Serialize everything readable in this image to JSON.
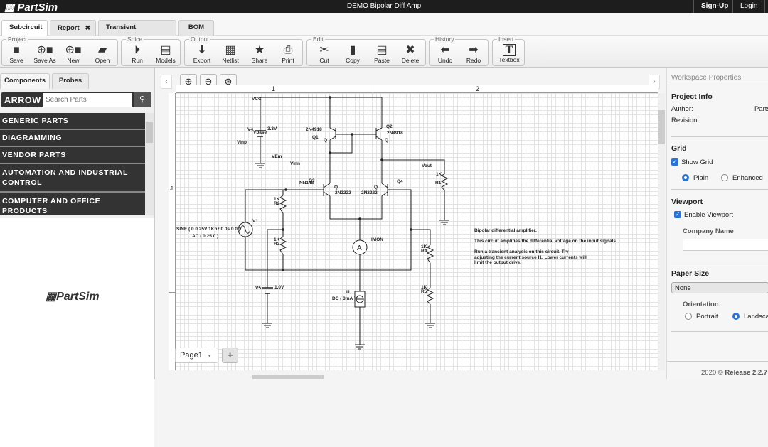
{
  "app": {
    "logo": "PartSim",
    "title": "DEMO Bipolar Diff Amp",
    "signup": "Sign-Up",
    "login": "Login"
  },
  "tabs": [
    {
      "label": "Subcircuit",
      "active": true
    },
    {
      "label": "Report",
      "closable": true
    },
    {
      "label": "Transient Analysis",
      "closable": true
    },
    {
      "label": "BOM"
    }
  ],
  "toolbar": {
    "groups": [
      {
        "label": "Project",
        "tools": [
          "Save",
          "Save As",
          "New",
          "Open"
        ]
      },
      {
        "label": "Spice",
        "tools": [
          "Run",
          "Models"
        ]
      },
      {
        "label": "Output",
        "tools": [
          "Export",
          "Netlist",
          "Share",
          "Print"
        ]
      },
      {
        "label": "Edit",
        "tools": [
          "Cut",
          "Copy",
          "Paste",
          "Delete"
        ]
      },
      {
        "label": "History",
        "tools": [
          "Undo",
          "Redo"
        ]
      },
      {
        "label": "Insert",
        "tools": [
          "Textbox"
        ]
      }
    ]
  },
  "left": {
    "tabs": [
      "Components",
      "Probes"
    ],
    "brand": "ARROW",
    "search_placeholder": "Search Parts",
    "categories": [
      "GENERIC PARTS",
      "DIAGRAMMING",
      "VENDOR PARTS",
      "AUTOMATION AND INDUSTRIAL CONTROL",
      "COMPUTER AND OFFICE PRODUCTS"
    ],
    "preview_logo": "PartSim"
  },
  "canvas": {
    "ruler_cols": [
      "1",
      "2"
    ],
    "ruler_rows": [
      "J"
    ],
    "page_tab": "Page1",
    "add_page": "+",
    "schematic": {
      "vcc": "VCC",
      "v4": "V4",
      "vbase": "Vbase",
      "v4_val": "3.3V",
      "vinp": "Vinp",
      "vem": "VEm",
      "vinn": "Vinn",
      "q1_model": "2N4918",
      "q1": "Q1",
      "q1_q": "Q",
      "q2": "Q2",
      "q2_model": "2N4918",
      "q2_q": "Q",
      "vout": "Vout",
      "r1_val": "1K",
      "r1": "R1",
      "nn": "NN148",
      "q3": "Q3",
      "q3_q": "Q",
      "q3_model": "2N2222",
      "q4_q": "Q",
      "q4_model": "2N2222",
      "q4": "Q4",
      "r2_val": "1K",
      "r2": "R2",
      "r3_val": "1K",
      "r3": "R3",
      "v1": "V1",
      "v1_sine": "SINE ( 0 0.25V 1Khz 0.0s 0.0 )",
      "v1_ac": "AC ( 0.25 0 )",
      "imon": "IMON",
      "ammeter": "A",
      "r4_val": "1K",
      "r4": "R4",
      "r5_val": "1K",
      "r5": "R5",
      "v5": "V5",
      "v5_val": "1.0V",
      "i1": "I1",
      "i1_val": "DC ( 3mA )",
      "note": [
        "Bipolar differential amplifier.",
        "This circuit amplifies the differential voltage on the input signals.",
        "Run a transient analysis on this circuit. Try",
        "adjusting the current source I1. Lower currents will",
        "limit the output drive."
      ]
    }
  },
  "right": {
    "title": "Workspace Properties",
    "project_info": "Project Info",
    "author_label": "Author:",
    "author": "Parts",
    "revision_label": "Revision:",
    "grid": "Grid",
    "show_grid": "Show Grid",
    "show_grid_checked": true,
    "plain": "Plain",
    "enhanced": "Enhanced",
    "grid_mode": "Plain",
    "viewport": "Viewport",
    "enable_viewport": "Enable Viewport",
    "enable_viewport_checked": true,
    "company_name": "Company Name",
    "company_value": "",
    "paper_size": "Paper Size",
    "paper_value": "None",
    "orientation": "Orientation",
    "portrait": "Portrait",
    "landscape": "Landscape",
    "orientation_value": "Landscape",
    "footer_year": "2020",
    "release": "Release 2.2.7"
  }
}
